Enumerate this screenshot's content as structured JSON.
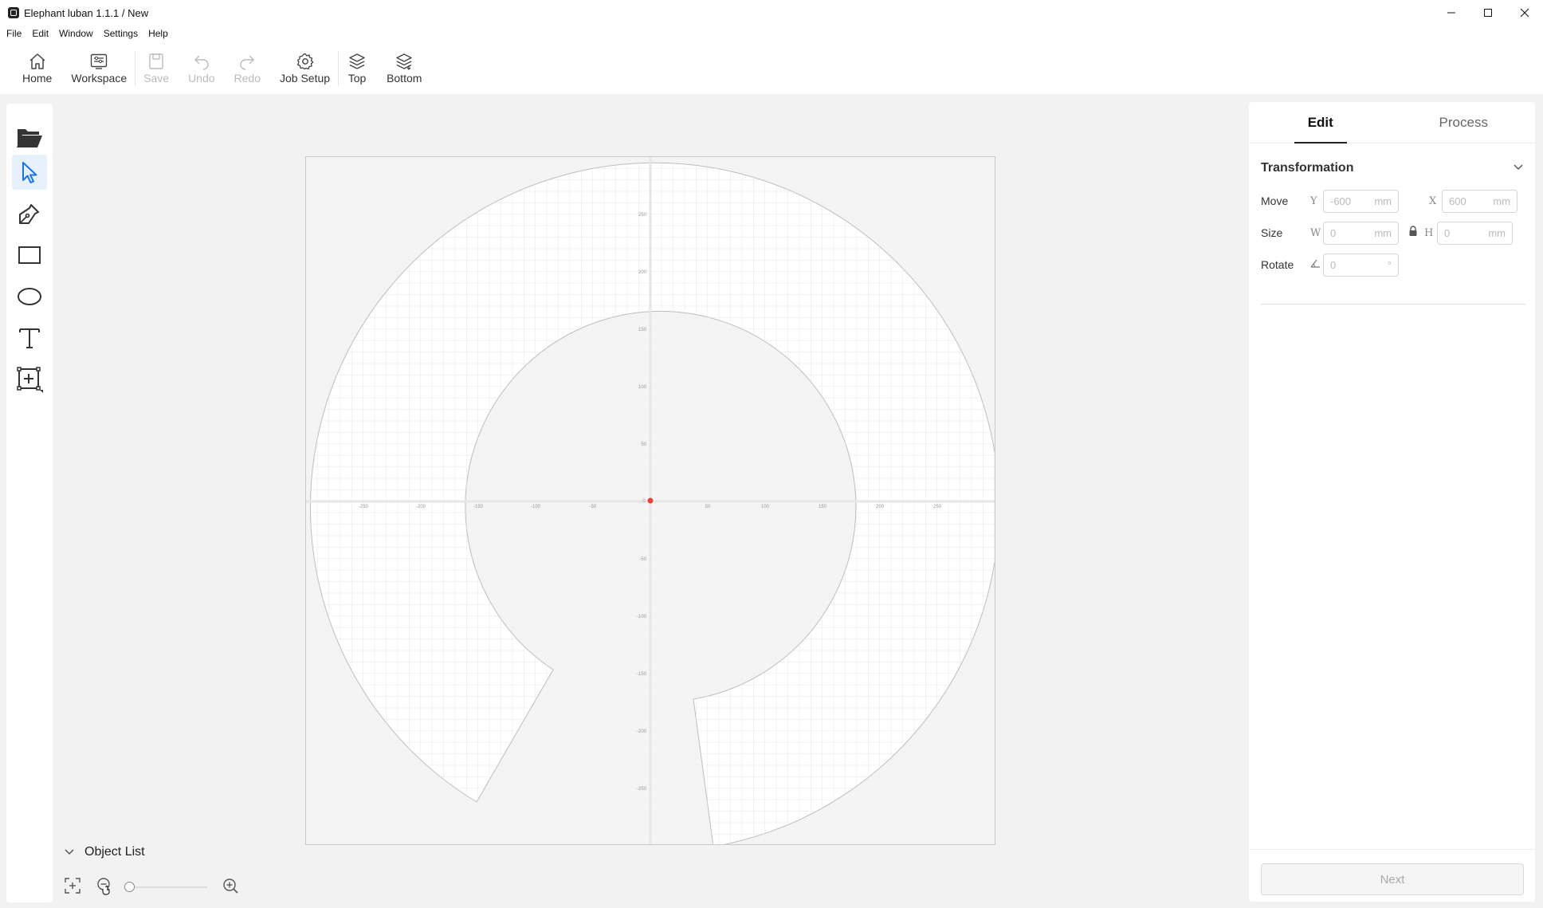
{
  "window": {
    "title": "Elephant luban 1.1.1 / New",
    "controls": [
      "minimize",
      "maximize",
      "close"
    ]
  },
  "menu": [
    "File",
    "Edit",
    "Window",
    "Settings",
    "Help"
  ],
  "toolbar": {
    "home": "Home",
    "workspace": "Workspace",
    "save": "Save",
    "undo": "Undo",
    "redo": "Redo",
    "job_setup": "Job Setup",
    "top": "Top",
    "bottom": "Bottom"
  },
  "tools": [
    "open-folder",
    "select",
    "pen",
    "rectangle",
    "ellipse",
    "text",
    "add-frame"
  ],
  "canvas": {
    "x_ticks": [
      "-250",
      "-200",
      "-150",
      "-100",
      "-50",
      "0",
      "50",
      "100",
      "150",
      "200",
      "250"
    ],
    "y_ticks": [
      "250",
      "200",
      "150",
      "100",
      "50",
      "-50",
      "-100",
      "-150",
      "-200",
      "-250"
    ],
    "origin_color": "#e8423c"
  },
  "object_list": {
    "label": "Object List"
  },
  "panel": {
    "tabs": {
      "edit": "Edit",
      "process": "Process"
    },
    "section": "Transformation",
    "move": {
      "label": "Move",
      "y_axis": "Y",
      "y_value": "-600",
      "x_axis": "X",
      "x_value": "600",
      "unit": "mm"
    },
    "size": {
      "label": "Size",
      "w_axis": "W",
      "w_value": "0",
      "h_axis": "H",
      "h_value": "0",
      "unit": "mm"
    },
    "rotate": {
      "label": "Rotate",
      "value": "0",
      "unit": "°"
    },
    "next": "Next"
  },
  "colors": {
    "accent": "#1a73e8",
    "origin": "#e8423c"
  }
}
